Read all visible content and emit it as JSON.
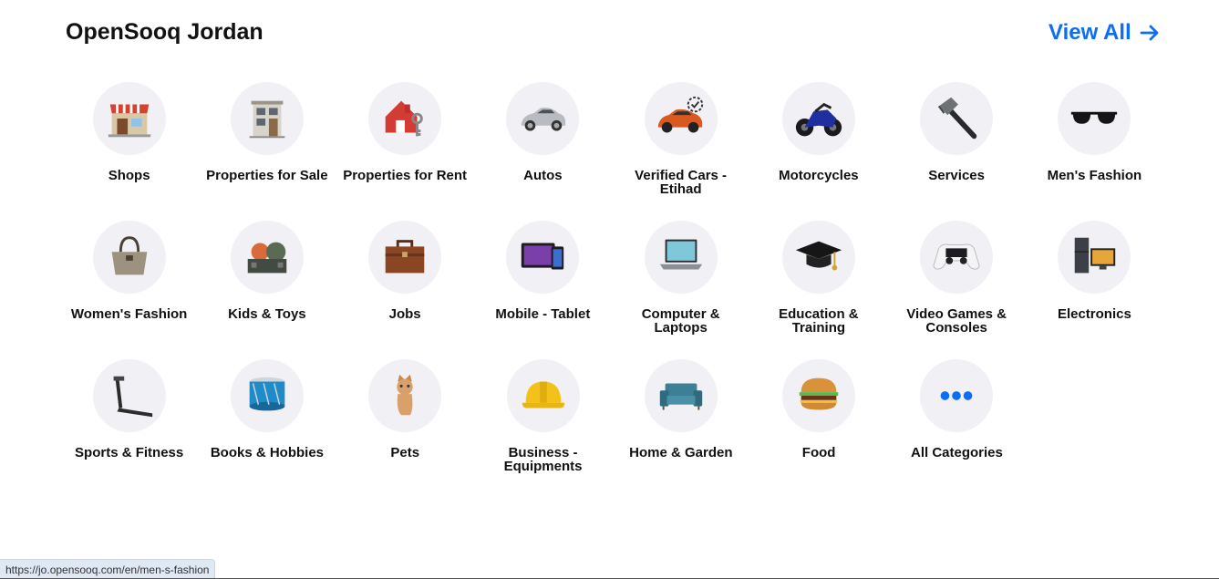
{
  "header": {
    "title": "OpenSooq Jordan",
    "view_all_label": "View All",
    "accent_color": "#0b6ef5"
  },
  "categories": [
    {
      "label": "Shops",
      "icon": "shop-icon"
    },
    {
      "label": "Properties for Sale",
      "icon": "building-icon"
    },
    {
      "label": "Properties for Rent",
      "icon": "house-key-icon"
    },
    {
      "label": "Autos",
      "icon": "car-icon"
    },
    {
      "label": "Verified Cars - Etihad",
      "icon": "verified-car-icon"
    },
    {
      "label": "Motorcycles",
      "icon": "motorcycle-icon"
    },
    {
      "label": "Services",
      "icon": "hammer-icon"
    },
    {
      "label": "Men's Fashion",
      "icon": "sunglasses-icon"
    },
    {
      "label": "Women's Fashion",
      "icon": "handbag-icon"
    },
    {
      "label": "Kids & Toys",
      "icon": "toy-icon"
    },
    {
      "label": "Jobs",
      "icon": "briefcase-icon"
    },
    {
      "label": "Mobile - Tablet",
      "icon": "tablet-phone-icon"
    },
    {
      "label": "Computer & Laptops",
      "icon": "laptop-icon"
    },
    {
      "label": "Education & Training",
      "icon": "graduation-cap-icon"
    },
    {
      "label": "Video Games & Consoles",
      "icon": "gamepad-icon"
    },
    {
      "label": "Electronics",
      "icon": "tv-fridge-icon"
    },
    {
      "label": "Sports & Fitness",
      "icon": "treadmill-icon"
    },
    {
      "label": "Books & Hobbies",
      "icon": "drum-icon"
    },
    {
      "label": "Pets",
      "icon": "cat-icon"
    },
    {
      "label": "Business - Equipments",
      "icon": "hard-hat-icon"
    },
    {
      "label": "Home & Garden",
      "icon": "sofa-icon"
    },
    {
      "label": "Food",
      "icon": "burger-icon"
    },
    {
      "label": "All Categories",
      "icon": "more-dots-icon"
    }
  ],
  "status_bar": {
    "url": "https://jo.opensooq.com/en/men-s-fashion"
  }
}
